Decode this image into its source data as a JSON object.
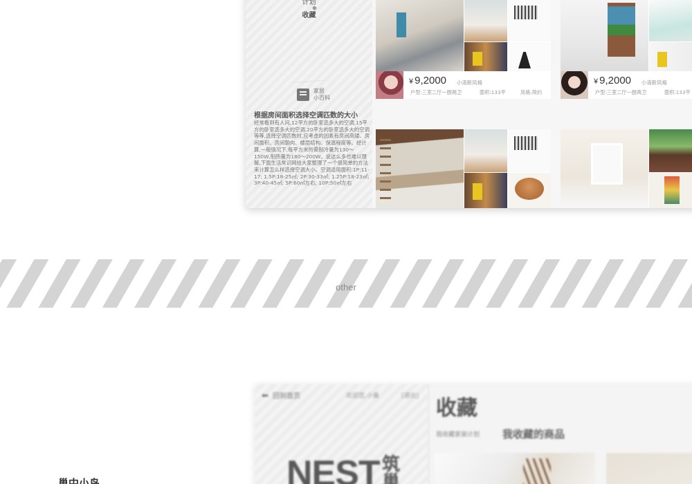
{
  "top_screen": {
    "left_panel": {
      "top_label": "计划",
      "favorites_label": "收藏",
      "wiki": {
        "line1": "家居",
        "line2": "小百科"
      },
      "article_title": "根据房间面积选择空调匹数的大小",
      "article_body": "经常看到有人问,12平方的卧室选多大的空调,15平方的卧室选多大的空调,20平方的卧室选多大的空调等等,选择空调匹数时,应考虑的因素有房间高矮、房间面积、房间朝向、楼层结构、保温程度等。经计算,一般情况下,每平方米所需制冷量为130～150W,制热量为180～200W。说这么多也难以理解,下面生活常识网给大家整理了一个很简单的方法来计算怎么样选择空调大小。空调适用面积:1P:11-17; 1.5P:18-25㎡; 2P:30-33㎡; 1.25P:18-23㎡; 3P:40-45㎡; 5P:60㎡左右; 10P:50㎡左右"
    },
    "products": [
      {
        "price": "9,2000",
        "currency": "¥",
        "style": "小清新风格",
        "layout": "户型:三室二厅一厨两卫",
        "area": "面积:133平",
        "style_tag": "风格:简约"
      },
      {
        "price": "9,2000",
        "currency": "¥",
        "style": "小清新风格",
        "layout": "户型:三室二厅一厨两卫",
        "area": "面积:133平"
      }
    ]
  },
  "section_divider": {
    "label": "other"
  },
  "bottom_screen": {
    "back_label": "回到首页",
    "welcome": "欢迎您,小巢",
    "logout": "[退出]",
    "logo_text": "NEST",
    "logo_cn": "筑巢",
    "page_title": "收藏",
    "sub_small": "我收藏家装计划",
    "sub_title": "我收藏的商品"
  },
  "corner_caption": "巢中小鸟",
  "colors": {
    "stripe": "#d4d4d4",
    "card_bg": "#f6f6f6",
    "text_dark": "#333333"
  }
}
